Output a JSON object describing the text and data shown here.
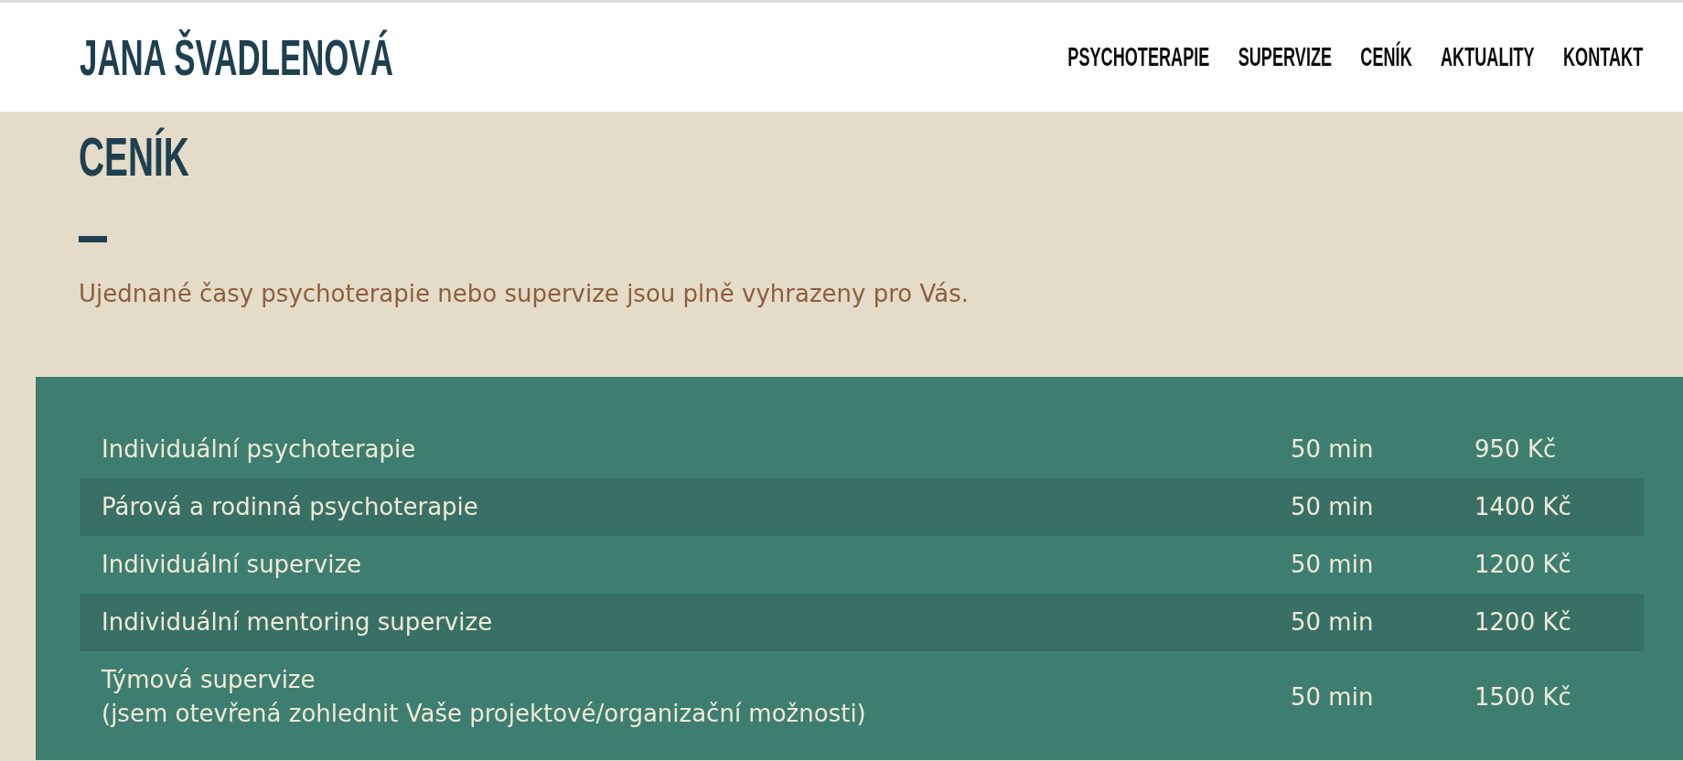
{
  "header": {
    "logo": "JANA ŠVADLENOVÁ",
    "nav": [
      {
        "label": "PSYCHOTERAPIE"
      },
      {
        "label": "SUPERVIZE"
      },
      {
        "label": "CENÍK"
      },
      {
        "label": "AKTUALITY"
      },
      {
        "label": "KONTAKT"
      }
    ]
  },
  "intro": {
    "title": "CENÍK",
    "text": "Ujednané časy psychoterapie nebo supervize jsou plně vyhrazeny pro Vás."
  },
  "price_table": {
    "rows": [
      {
        "service": "Individuální psychoterapie",
        "duration": "50 min",
        "price": "950 Kč"
      },
      {
        "service": "Párová a rodinná psychoterapie",
        "duration": "50 min",
        "price": "1400 Kč"
      },
      {
        "service": "Individuální supervize",
        "duration": "50 min",
        "price": "1200 Kč"
      },
      {
        "service": "Individuální mentoring supervize",
        "duration": "50 min",
        "price": "1200 Kč"
      },
      {
        "service": "Týmová supervize",
        "note": "(jsem otevřená zohlednit Vaše projektové/organizační možnosti)",
        "duration": "50 min",
        "price": "1500 Kč"
      }
    ]
  }
}
